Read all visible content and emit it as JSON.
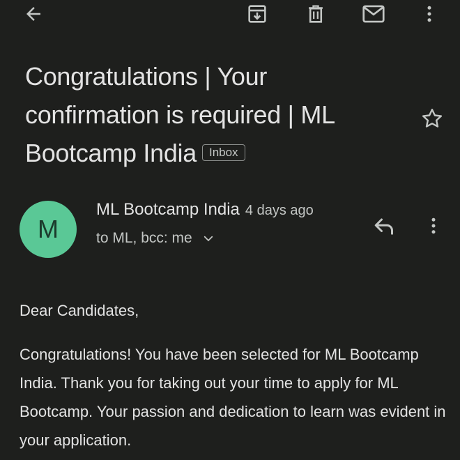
{
  "toolbar": {
    "back": "arrow-back-icon",
    "archive": "archive-icon",
    "delete": "trash-icon",
    "mark_unread": "mail-icon",
    "more": "more-vert-icon"
  },
  "email": {
    "subject": "Congratulations | Your confirmation is required | ML Bootcamp India",
    "label": "Inbox",
    "sender_name": "ML Bootcamp India",
    "sender_initial": "M",
    "time": "4 days ago",
    "recipients": "to ML, bcc: me",
    "body_greeting": "Dear Candidates,",
    "body_paragraph": "Congratulations! You have been selected for ML Bootcamp India. Thank you for taking out your time to apply for ML Bootcamp. Your passion and dedication to learn was evident in your application."
  },
  "colors": {
    "background": "#1e1f1d",
    "text_primary": "#e3e3e3",
    "text_secondary": "#c4c7c5",
    "avatar": "#5ac896"
  }
}
